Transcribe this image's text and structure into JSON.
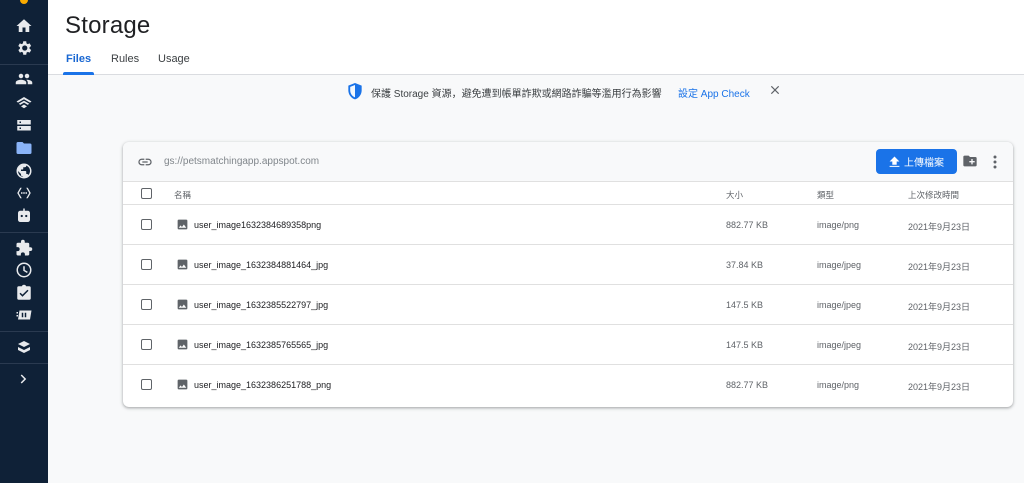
{
  "page": {
    "title": "Storage",
    "tabs": [
      {
        "label": "Files",
        "active": true
      },
      {
        "label": "Rules",
        "active": false
      },
      {
        "label": "Usage",
        "active": false
      }
    ]
  },
  "banner": {
    "text": "保護 Storage 資源，避免遭到帳單詐欺或網路詐騙等濫用行為影響",
    "link": "設定 App Check"
  },
  "toolbar": {
    "bucket_path": "gs://petsmatchingapp.appspot.com",
    "upload_label": "上傳檔案"
  },
  "table": {
    "headers": {
      "name": "名稱",
      "size": "大小",
      "type": "類型",
      "date": "上次修改時間"
    },
    "rows": [
      {
        "name": "user_image1632384689358png",
        "size": "882.77 KB",
        "type": "image/png",
        "date": "2021年9月23日"
      },
      {
        "name": "user_image_1632384881464_jpg",
        "size": "37.84 KB",
        "type": "image/jpeg",
        "date": "2021年9月23日"
      },
      {
        "name": "user_image_1632385522797_jpg",
        "size": "147.5 KB",
        "type": "image/jpeg",
        "date": "2021年9月23日"
      },
      {
        "name": "user_image_1632385765565_jpg",
        "size": "147.5 KB",
        "type": "image/jpeg",
        "date": "2021年9月23日"
      },
      {
        "name": "user_image_1632386251788_png",
        "size": "882.77 KB",
        "type": "image/png",
        "date": "2021年9月23日"
      }
    ]
  },
  "sidebar": {
    "icons": [
      "home-icon",
      "settings-icon",
      "users-icon",
      "hosting-icon",
      "database-icon",
      "storage-icon",
      "globe-icon",
      "functions-icon",
      "ml-robot-icon",
      "extensions-icon",
      "performance-icon",
      "test-lab-icon",
      "app-distribution-icon",
      "engage-icon",
      "expand-chevron-icon"
    ],
    "active": "storage-icon"
  },
  "colors": {
    "rail": "#0f2137",
    "accent": "#1a73e8",
    "background": "#f8f9fa"
  }
}
